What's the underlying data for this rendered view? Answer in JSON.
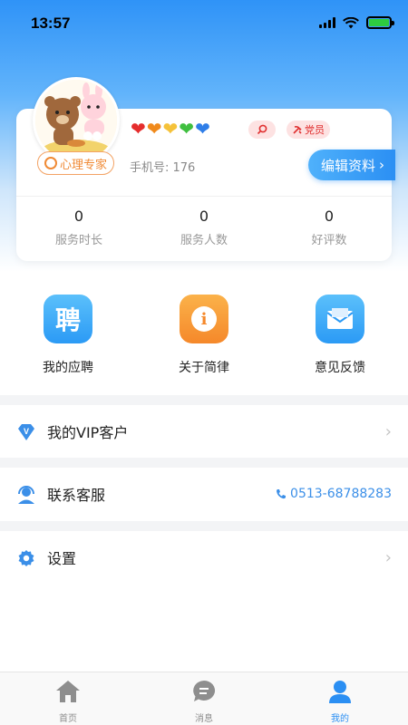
{
  "status_bar": {
    "time": "13:57",
    "icons": [
      "signal-icon",
      "wifi-icon",
      "battery-charging-icon"
    ]
  },
  "profile": {
    "badge_label": "心理专家",
    "hearts": [
      "❤",
      "❤",
      "❤",
      "❤",
      "❤"
    ],
    "heart_colors": [
      "#e52d2d",
      "#f08a1c",
      "#f5c23a",
      "#3fbf3f",
      "#2f7ee8"
    ],
    "party_label": "党员",
    "phone_label": "手机号: 176",
    "edit_button": "编辑资料"
  },
  "stats": [
    {
      "value": "0",
      "label": "服务时长"
    },
    {
      "value": "0",
      "label": "服务人数"
    },
    {
      "value": "0",
      "label": "好评数"
    }
  ],
  "quick_actions": [
    {
      "label": "我的应聘",
      "icon": "recruit-icon",
      "glyph": "聘"
    },
    {
      "label": "关于简律",
      "icon": "info-icon",
      "glyph": "i"
    },
    {
      "label": "意见反馈",
      "icon": "mail-icon",
      "glyph": ""
    }
  ],
  "menu": {
    "vip": {
      "label": "我的VIP客户",
      "icon": "vip-diamond-icon"
    },
    "service": {
      "label": "联系客服",
      "icon": "customer-service-icon",
      "phone": "0513-68788283"
    },
    "settings": {
      "label": "设置",
      "icon": "gear-icon"
    }
  },
  "tabs": [
    {
      "label": "首页",
      "icon": "home-icon",
      "active": false
    },
    {
      "label": "消息",
      "icon": "message-icon",
      "active": false
    },
    {
      "label": "我的",
      "icon": "user-icon",
      "active": true
    }
  ],
  "colors": {
    "primary": "#2b8ff3",
    "accent_orange": "#f08a35",
    "party_red": "#e03030"
  }
}
